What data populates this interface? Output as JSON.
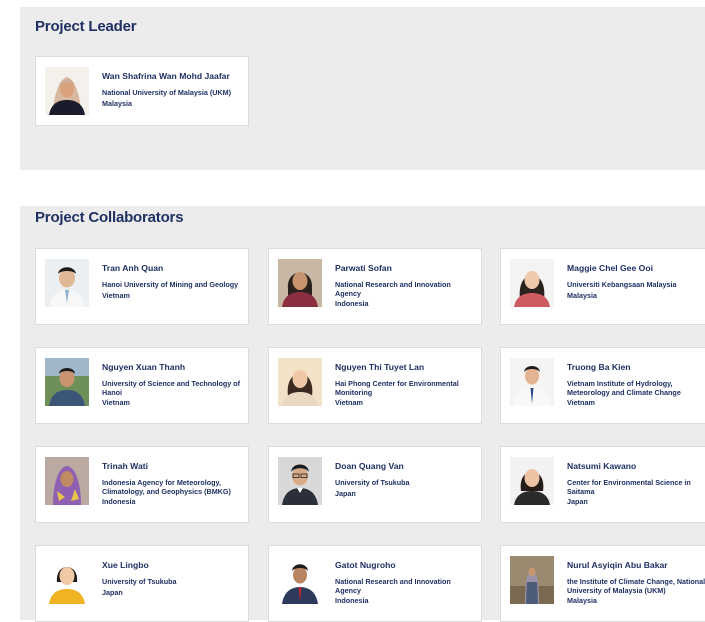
{
  "leader_section": {
    "heading": "Project Leader",
    "people": [
      {
        "name": "Wan Shafrina Wan Mohd Jaafar",
        "org": "National University of Malaysia (UKM)",
        "country": "Malaysia",
        "avatar": "woman-hijab-dark"
      }
    ]
  },
  "collaborators_section": {
    "heading": "Project Collaborators",
    "people": [
      {
        "name": "Tran Anh Quan",
        "org": "Hanoi University of Mining and Geology",
        "country": "Vietnam",
        "avatar": "man-white-shirt"
      },
      {
        "name": "Parwati Sofan",
        "org": "National Research and Innovation Agency",
        "country": "Indonesia",
        "avatar": "woman-dark-hair"
      },
      {
        "name": "Maggie Chel Gee Ooi",
        "org": "Universiti Kebangsaan Malaysia",
        "country": "Malaysia",
        "avatar": "woman-long-hair"
      },
      {
        "name": "Nguyen Xuan Thanh",
        "org": "University of Science and Technology of Hanoi",
        "country": "Vietnam",
        "avatar": "man-outdoor"
      },
      {
        "name": "Nguyen Thi Tuyet Lan",
        "org": "Hai Phong Center for Environmental Monitoring",
        "country": "Vietnam",
        "avatar": "woman-light"
      },
      {
        "name": "Truong Ba Kien",
        "org": "Vietnam Institute of Hydrology, Meteorology and Climate Change",
        "country": "Vietnam",
        "avatar": "man-tie"
      },
      {
        "name": "Trinah Wati",
        "org": "Indonesia Agency for Meteorology, Climatology, and Geophysics (BMKG)",
        "country": "Indonesia",
        "avatar": "woman-hijab-colorful"
      },
      {
        "name": "Doan Quang Van",
        "org": "University of Tsukuba",
        "country": "Japan",
        "avatar": "man-glasses-suit"
      },
      {
        "name": "Natsumi Kawano",
        "org": "Center for Environmental Science in Saitama",
        "country": "Japan",
        "avatar": "woman-short-hair"
      },
      {
        "name": "Xue Lingbo",
        "org": "University of Tsukuba",
        "country": "Japan",
        "avatar": "woman-yellow-top"
      },
      {
        "name": "Gatot Nugroho",
        "org": "National Research and Innovation Agency",
        "country": "Indonesia",
        "avatar": "man-red-tie"
      },
      {
        "name": "Nurul Asyiqin Abu Bakar",
        "org": "the Institute of Climate Change, National University of Malaysia (UKM)",
        "country": "Malaysia",
        "avatar": "woman-hijab-standing"
      }
    ]
  },
  "colors": {
    "heading": "#1f3064",
    "panel": "#ececec",
    "card_border": "#dcdcdc"
  }
}
